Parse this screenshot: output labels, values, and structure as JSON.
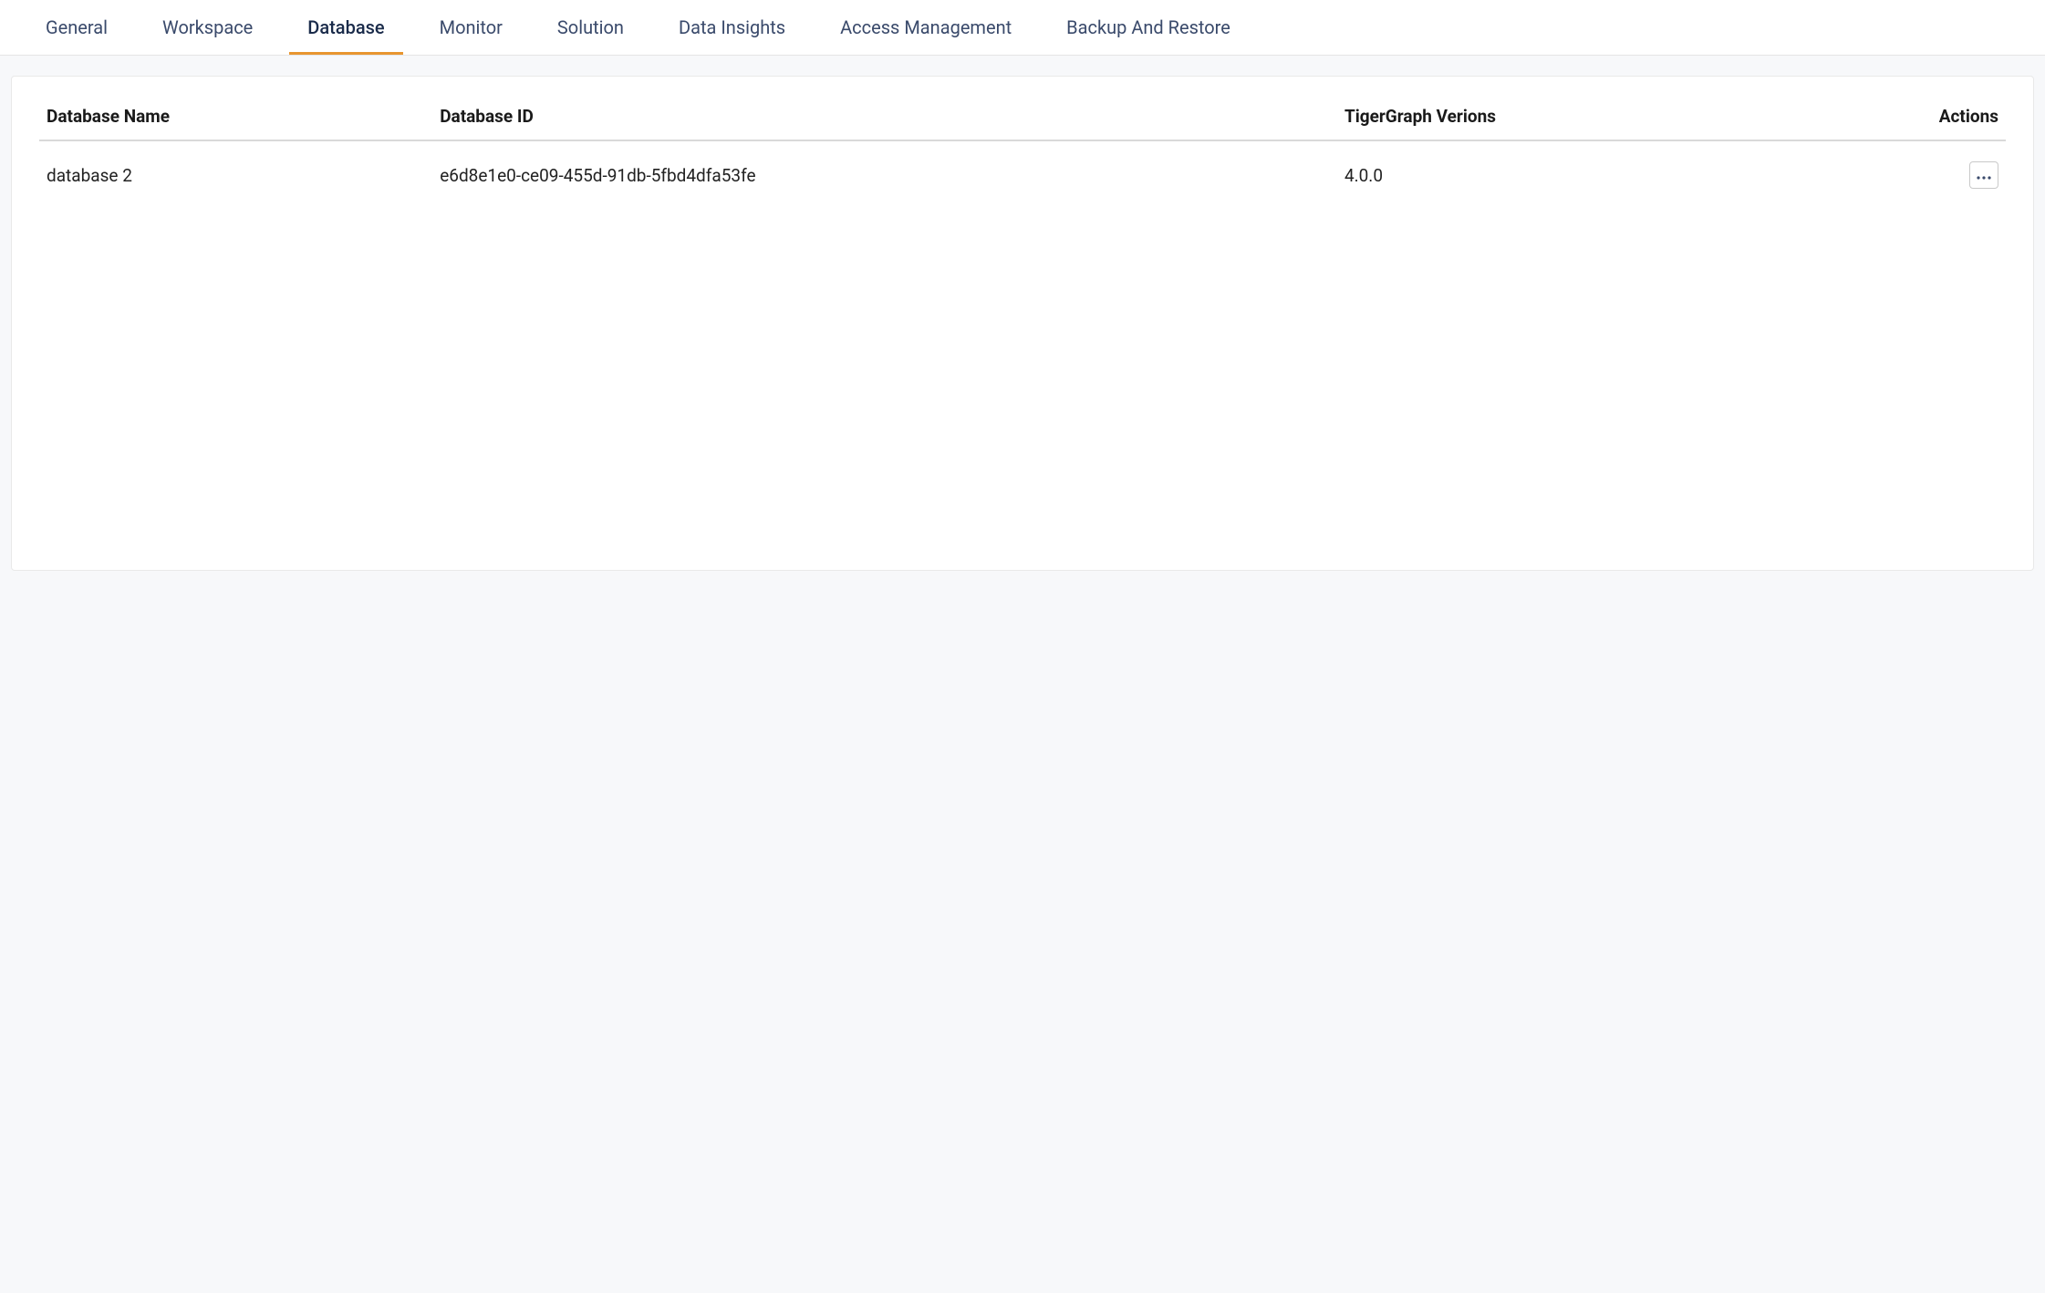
{
  "tabs": [
    {
      "label": "General",
      "active": false
    },
    {
      "label": "Workspace",
      "active": false
    },
    {
      "label": "Database",
      "active": true
    },
    {
      "label": "Monitor",
      "active": false
    },
    {
      "label": "Solution",
      "active": false
    },
    {
      "label": "Data Insights",
      "active": false
    },
    {
      "label": "Access Management",
      "active": false
    },
    {
      "label": "Backup And Restore",
      "active": false
    }
  ],
  "table": {
    "headers": {
      "name": "Database Name",
      "id": "Database ID",
      "version": "TigerGraph Verions",
      "actions": "Actions"
    },
    "rows": [
      {
        "name": "database 2",
        "id": "e6d8e1e0-ce09-455d-91db-5fbd4dfa53fe",
        "version": "4.0.0"
      }
    ]
  }
}
